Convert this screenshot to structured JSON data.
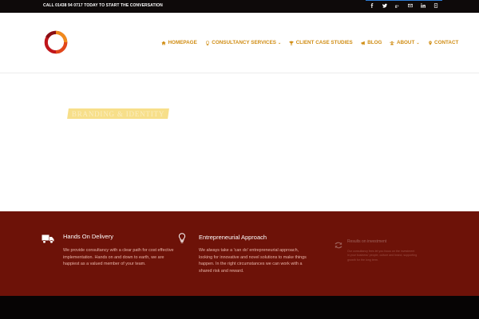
{
  "topbar": {
    "call_text": "CALL 01438 94 0717 TODAY TO START THE CONVERSATION",
    "social_icons": [
      "facebook-icon",
      "twitter-icon",
      "google-plus-icon",
      "email-icon",
      "linkedin-icon",
      "youtube-icon"
    ]
  },
  "nav": {
    "items": [
      {
        "label": "HOMEPAGE",
        "icon": "home-icon",
        "has_dropdown": false
      },
      {
        "label": "CONSULTANCY SERVICES",
        "icon": "lightbulb-icon",
        "has_dropdown": true
      },
      {
        "label": "CLIENT CASE STUDIES",
        "icon": "trophy-icon",
        "has_dropdown": false
      },
      {
        "label": "BLOG",
        "icon": "bullhorn-icon",
        "has_dropdown": false
      },
      {
        "label": "ABOUT",
        "icon": "users-icon",
        "has_dropdown": true
      },
      {
        "label": "CONTACT",
        "icon": "map-marker-icon",
        "has_dropdown": false
      }
    ],
    "caret": "⌄"
  },
  "hero": {
    "title": "BRANDING & IDENTITY"
  },
  "features": [
    {
      "icon": "truck-icon",
      "title": "Hands On Delivery",
      "text": "We provide consultancy with a clear path for cost effective implementation. Hands on and down to earth, we are happiest as a valued member of your team."
    },
    {
      "icon": "lightbulb-icon",
      "title": "Entrepreneurial Approach",
      "text": "We always take a 'can do' entrepreneurial approach, looking for innovative and novel solutions to make things happen. In the right circumstances we can work with a shared risk and reward."
    },
    {
      "icon": "refresh-icon",
      "title": "Results on investment",
      "text": "Our consultancy fees let you focus on the investment in your business' people, culture and brand, supporting growth for the long term."
    }
  ],
  "colors": {
    "accent": "#d08d14",
    "band": "#6d1208",
    "topbar": "#0e0a0a",
    "hero_title_bg": "#f7df8a"
  }
}
